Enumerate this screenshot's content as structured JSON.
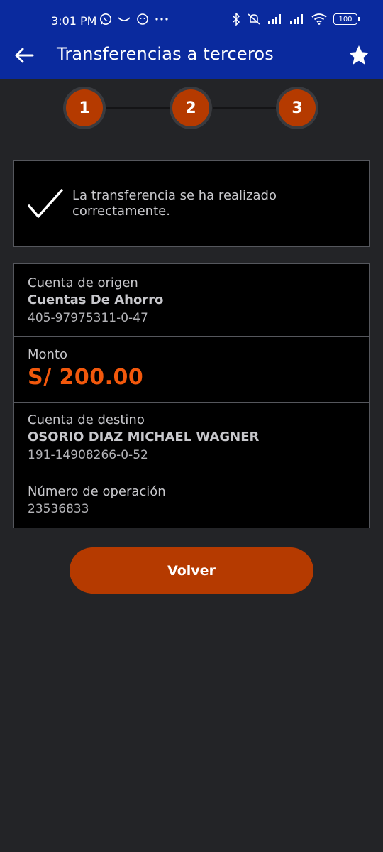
{
  "status_bar": {
    "time": "3:01 PM",
    "icons_left": [
      "whatsapp-icon",
      "wave-icon",
      "face-icon",
      "more-dots-icon"
    ],
    "icons_right": [
      "bluetooth-icon",
      "mute-icon",
      "signal-icon",
      "signal-icon",
      "wifi-icon"
    ],
    "battery": "100"
  },
  "app_bar": {
    "title": "Transferencias a terceros",
    "back_icon": "arrow-left-icon",
    "favorite_icon": "star-icon"
  },
  "stepper": {
    "steps": [
      "1",
      "2",
      "3"
    ]
  },
  "success": {
    "message": "La transferencia se ha realizado correctamente."
  },
  "details": {
    "origin": {
      "label": "Cuenta de origen",
      "name": "Cuentas De Ahorro",
      "number": "405-97975311-0-47"
    },
    "amount": {
      "label": "Monto",
      "value": "S/ 200.00"
    },
    "destination": {
      "label": "Cuenta de destino",
      "name": "OSORIO DIAZ MICHAEL WAGNER",
      "number": "191-14908266-0-52"
    },
    "operation": {
      "label": "Número de operación",
      "value": "23536833"
    }
  },
  "actions": {
    "back_button": "Volver"
  },
  "colors": {
    "header_blue": "#0a2a9e",
    "accent_orange": "#b53a00",
    "amount_orange": "#f2580c",
    "background": "#232427"
  }
}
